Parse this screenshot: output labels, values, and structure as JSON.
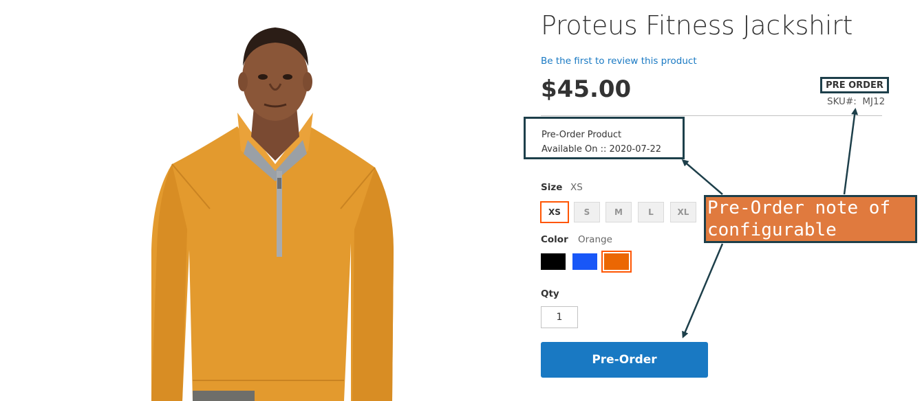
{
  "product": {
    "title": "Proteus Fitness Jackshirt",
    "review_link": "Be the first to review this product",
    "price": "$45.00",
    "stock_badge": "PRE ORDER",
    "sku_label": "SKU#:",
    "sku_value": "MJ12"
  },
  "preorder_note": {
    "line1": "Pre-Order Product",
    "line2": "Available On :: 2020-07-22"
  },
  "options": {
    "size": {
      "label": "Size",
      "selected": "XS",
      "values": [
        "XS",
        "S",
        "M",
        "L",
        "XL"
      ]
    },
    "color": {
      "label": "Color",
      "selected": "Orange",
      "values": [
        {
          "name": "Black",
          "hex": "#000000"
        },
        {
          "name": "Blue",
          "hex": "#1857f7"
        },
        {
          "name": "Orange",
          "hex": "#eb6703"
        }
      ]
    }
  },
  "qty": {
    "label": "Qty",
    "value": "1"
  },
  "buttons": {
    "preorder": "Pre-Order"
  },
  "annotation": {
    "line1": "Pre-Order note of",
    "line2": "configurable product"
  },
  "colors": {
    "accent": "#1979c3",
    "selected_border": "#ff5501",
    "callout_bg": "#e07a3e",
    "callout_border": "#1d3f4a"
  }
}
